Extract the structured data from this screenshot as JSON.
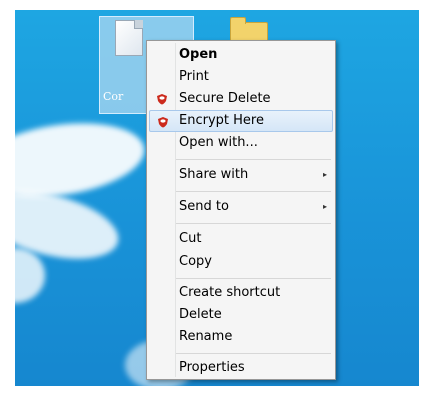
{
  "desktop": {
    "icon_label": "Cor"
  },
  "context_menu": {
    "items": [
      {
        "label": "Open",
        "bold": true
      },
      {
        "label": "Print"
      },
      {
        "label": "Secure Delete",
        "icon": "shield-icon"
      },
      {
        "label": "Encrypt Here",
        "icon": "shield-icon",
        "highlighted": true
      },
      {
        "label": "Open with..."
      },
      {
        "label": "Share with",
        "submenu": true
      },
      {
        "label": "Send to",
        "submenu": true
      },
      {
        "label": "Cut"
      },
      {
        "label": "Copy"
      },
      {
        "label": "Create shortcut"
      },
      {
        "label": "Delete"
      },
      {
        "label": "Rename"
      },
      {
        "label": "Properties"
      }
    ],
    "submenu_glyph": "▸",
    "accent_icon_color": "#cc2a1c",
    "highlight_color": "#d5e6f7"
  }
}
